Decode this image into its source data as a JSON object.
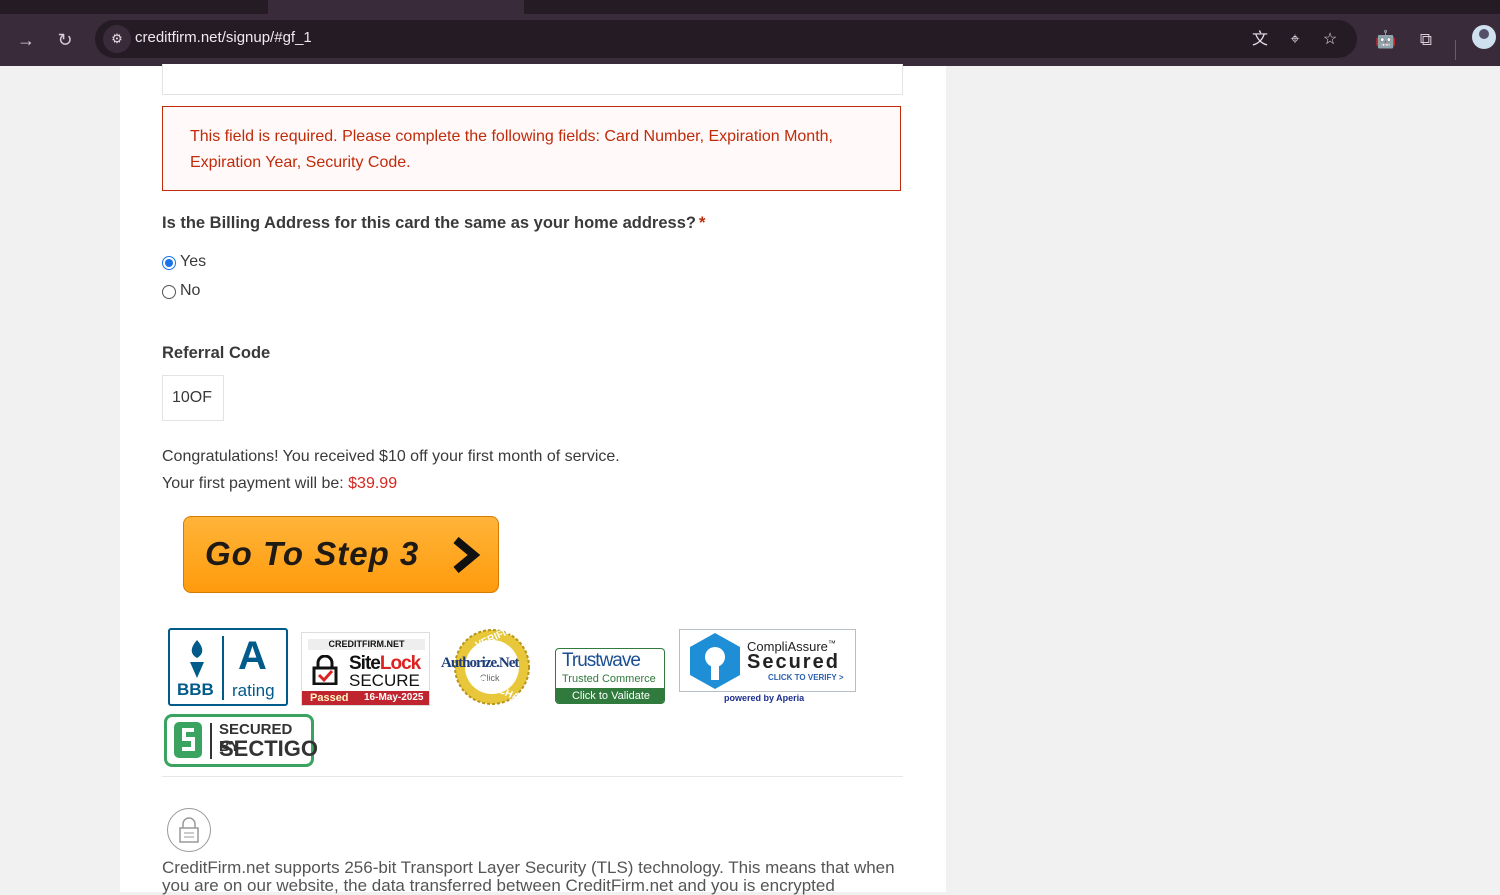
{
  "browser": {
    "url": "creditfirm.net/signup/#gf_1"
  },
  "form": {
    "error_message": "This field is required. Please complete the following fields: Card Number, Expiration Month, Expiration Year, Security Code.",
    "billing_question": "Is the Billing Address for this card the same as your home address?",
    "required_mark": "*",
    "options": [
      {
        "label": "Yes",
        "checked": true
      },
      {
        "label": "No",
        "checked": false
      }
    ],
    "referral_label": "Referral Code",
    "referral_value": "10OF",
    "congrats_line": "Congratulations! You received $10 off your first month of service.",
    "payment_prefix": "Your first payment will be: ",
    "payment_amount": "$39.99",
    "next_button": "Go To Step 3"
  },
  "badges": {
    "bbb": {
      "left": "BBB",
      "grade": "A",
      "right": "rating"
    },
    "sitelock": {
      "top": "CREDITFIRM.NET",
      "site": "Site",
      "lock": "Lock",
      "secure": "SECURE",
      "passed": "Passed",
      "date": "16-May-2025"
    },
    "authorize": {
      "ring_top": "VERIFIED",
      "name": "Authorize.Net",
      "click": "Click",
      "ring_bottom": "MERCHANT"
    },
    "trustwave": {
      "name": "Trustwave",
      "trusted": "Trusted Commerce",
      "validate": "Click to Validate"
    },
    "compliassure": {
      "name": "CompliAssure",
      "tm": "™",
      "secured": "Secured",
      "verify": "CLICK TO VERIFY >",
      "powered": "powered by Aperia"
    },
    "sectigo": {
      "by": "SECURED BY",
      "name": "SECTIGO"
    }
  },
  "footer": {
    "tls_text": "CreditFirm.net supports 256-bit Transport Layer Security (TLS) technology. This means that when you are on our website, the data transferred between CreditFirm.net and you is encrypted"
  },
  "colors": {
    "error": "#c02b0a",
    "price": "#d6261e",
    "button": "#ff9b0c",
    "chrome": "#3a2b3a"
  }
}
